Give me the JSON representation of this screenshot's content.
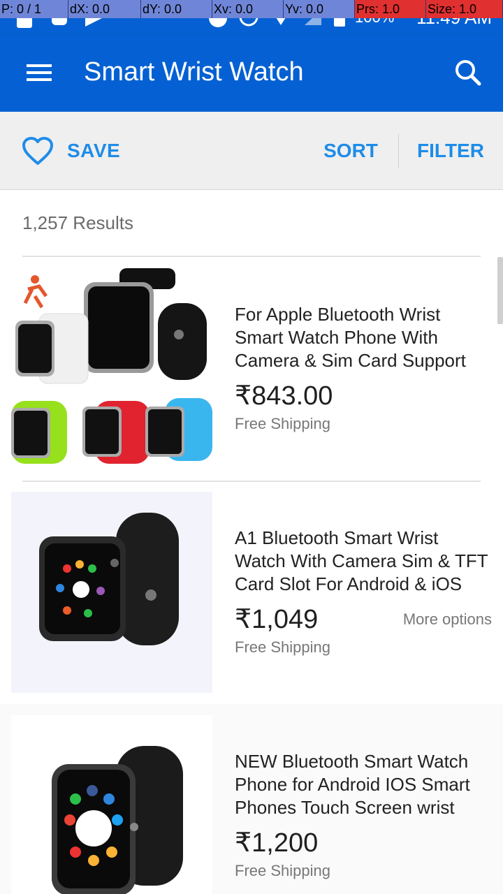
{
  "status_bar": {
    "debug": [
      "P: 0 / 1",
      "dX: 0.0",
      "dY: 0.0",
      "Xv: 0.0",
      "Yv: 0.0",
      "Prs: 1.0",
      "Size: 1.0"
    ],
    "battery_text": "100%",
    "time": "11:49 AM"
  },
  "app_bar": {
    "title": "Smart Wrist Watch"
  },
  "actions": {
    "save": "SAVE",
    "sort": "SORT",
    "filter": "FILTER"
  },
  "results_count": "1,257 Results",
  "products": [
    {
      "title": "For Apple Bluetooth Wrist Smart Watch Phone With Camera & Sim Card Support",
      "price": "₹843.00",
      "shipping": "Free Shipping"
    },
    {
      "title": "A1 Bluetooth Smart Wrist Watch With Camera Sim & TFT Card Slot For Android & iOS",
      "price": "₹1,049",
      "shipping": "Free Shipping",
      "more": "More options"
    },
    {
      "title": "NEW Bluetooth Smart Watch Phone for Android IOS Smart Phones Touch Screen wrist",
      "price": "₹1,200",
      "shipping": "Free Shipping"
    }
  ],
  "colors": {
    "primary": "#0561d3",
    "accent": "#1e8ce8",
    "toolbar_bg": "#efefef"
  }
}
